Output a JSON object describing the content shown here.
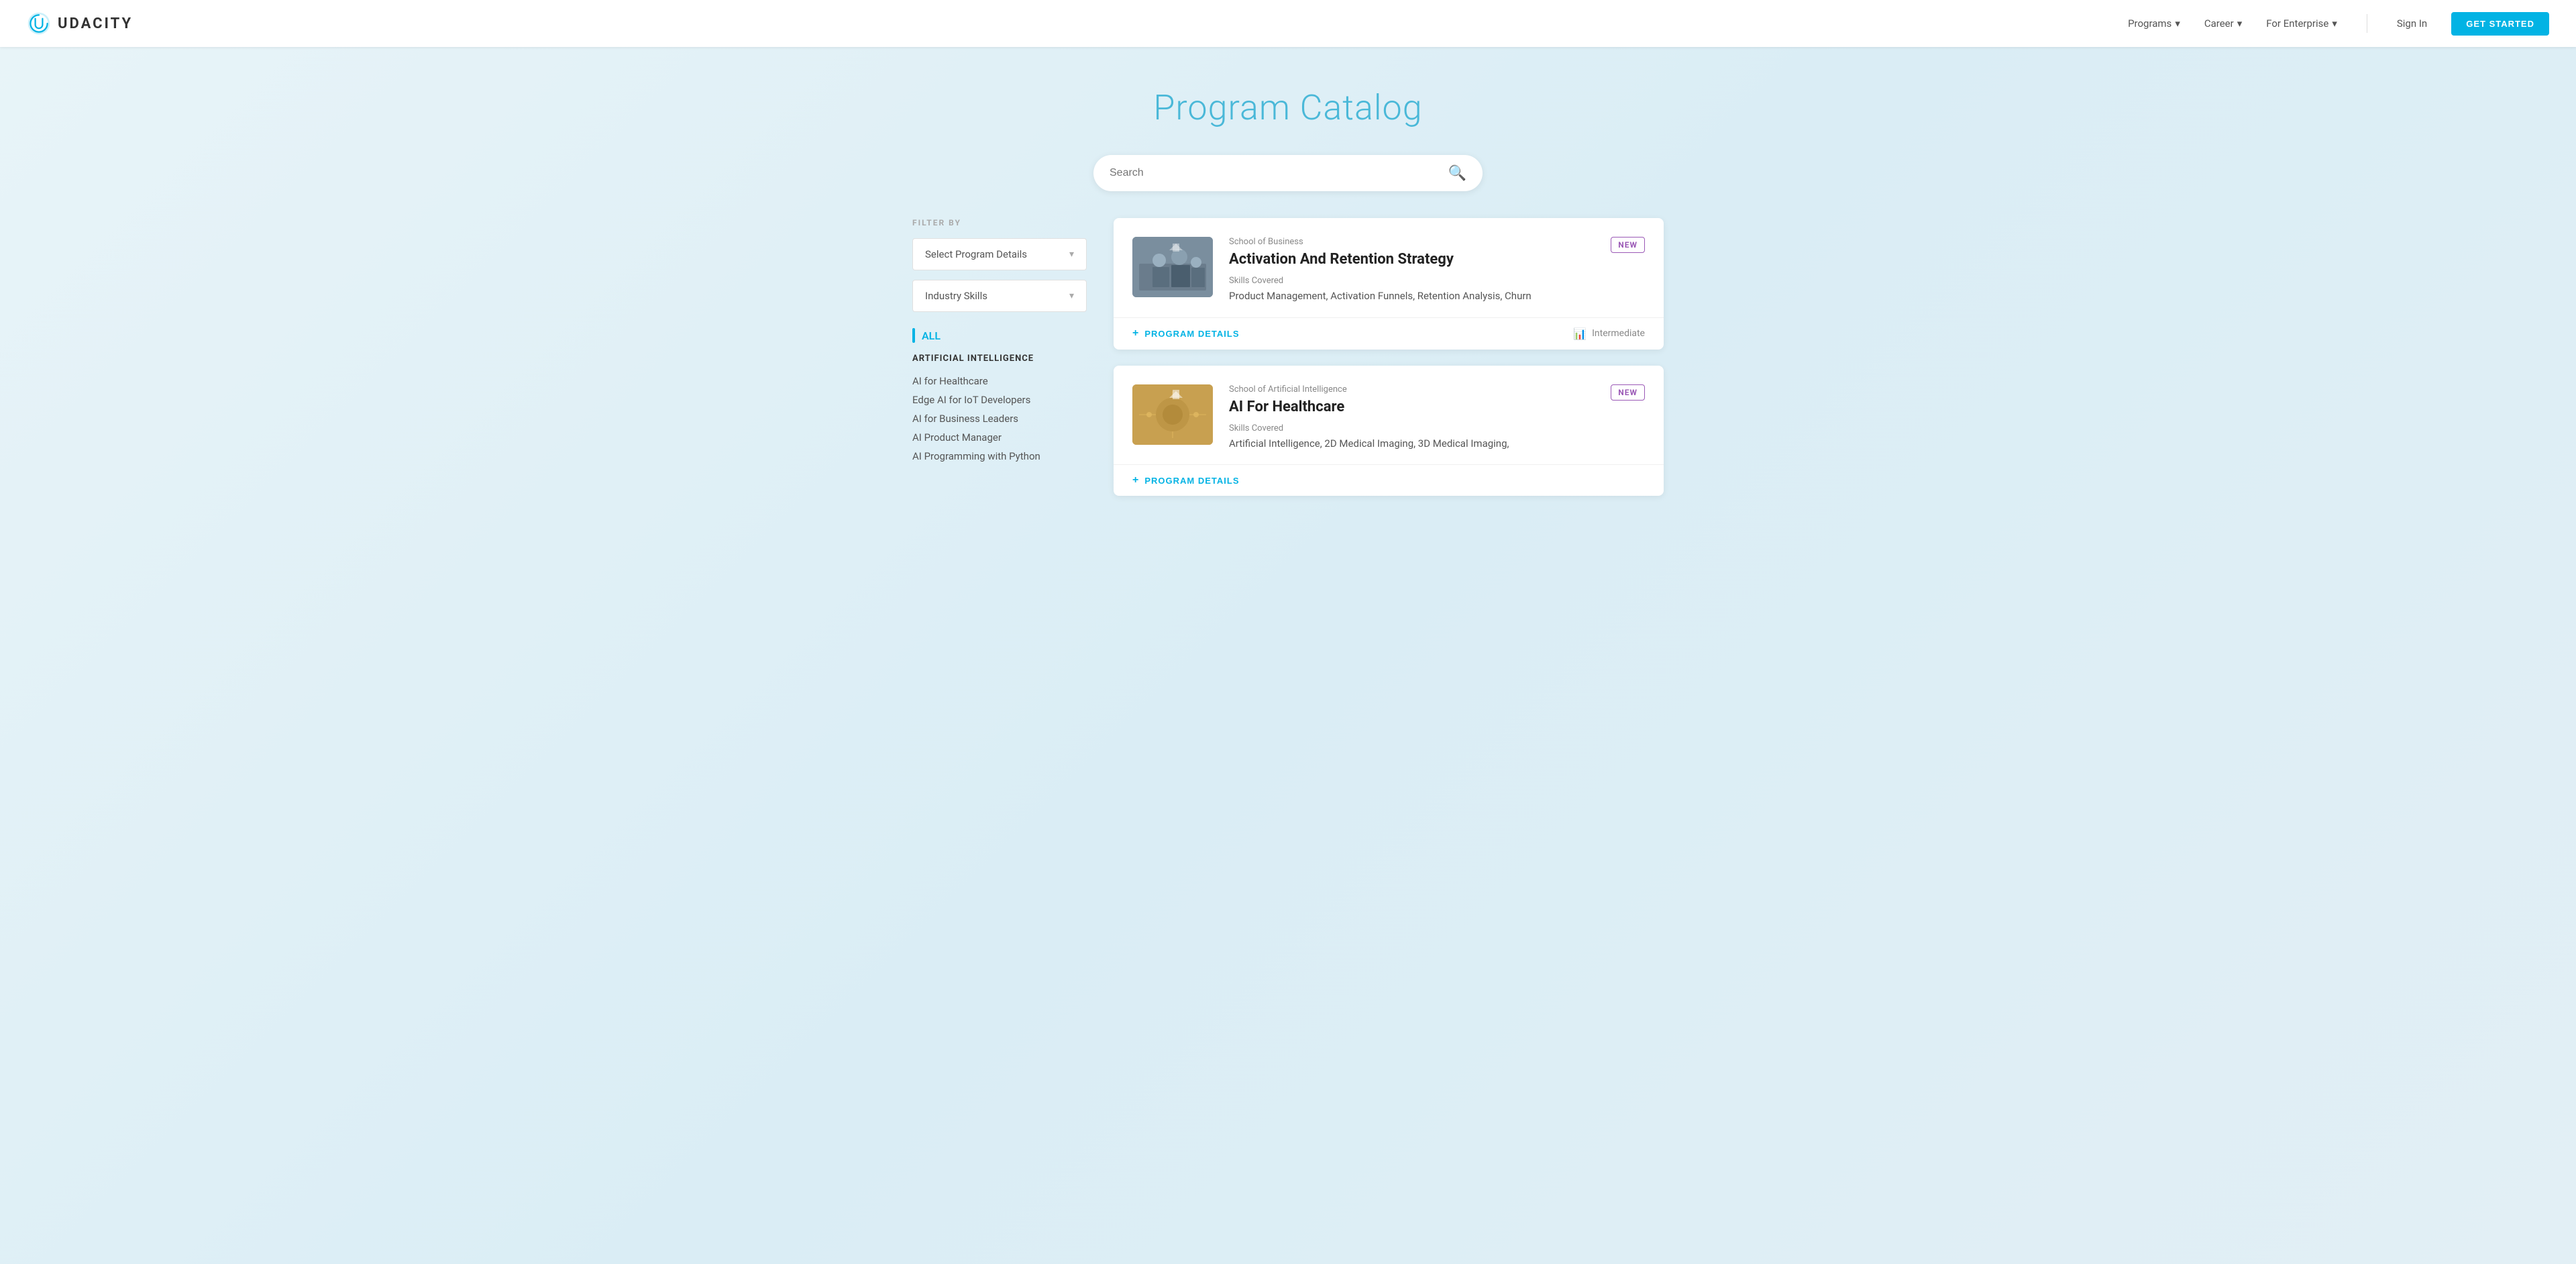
{
  "nav": {
    "logo_text": "UDACITY",
    "links": [
      {
        "label": "Programs",
        "has_chevron": true
      },
      {
        "label": "Career",
        "has_chevron": true
      },
      {
        "label": "For Enterprise",
        "has_chevron": true
      }
    ],
    "sign_in": "Sign In",
    "get_started": "GET STARTED"
  },
  "hero": {
    "title": "Program Catalog"
  },
  "search": {
    "placeholder": "Search"
  },
  "sidebar": {
    "filter_label": "FILTER BY",
    "dropdown1": "Select Program Details",
    "dropdown2": "Industry Skills",
    "all_label": "ALL",
    "categories": [
      {
        "title": "ARTIFICIAL INTELLIGENCE",
        "items": [
          "AI for Healthcare",
          "Edge AI for IoT Developers",
          "AI for Business Leaders",
          "AI Product Manager",
          "AI Programming with Python"
        ]
      }
    ]
  },
  "cards": [
    {
      "id": "card1",
      "badge": "NEW",
      "school": "School of Business",
      "title": "Activation And Retention Strategy",
      "skills_label": "Skills Covered",
      "skills": "Product Management, Activation Funnels, Retention Analysis, Churn",
      "level": "Intermediate",
      "thumb_type": "business",
      "program_details_label": "PROGRAM DETAILS"
    },
    {
      "id": "card2",
      "badge": "NEW",
      "school": "School of Artificial Intelligence",
      "title": "AI For Healthcare",
      "skills_label": "Skills Covered",
      "skills": "Artificial Intelligence, 2D Medical Imaging, 3D Medical Imaging,",
      "level": "",
      "thumb_type": "ai",
      "program_details_label": "PROGRAM DETAILS"
    }
  ]
}
